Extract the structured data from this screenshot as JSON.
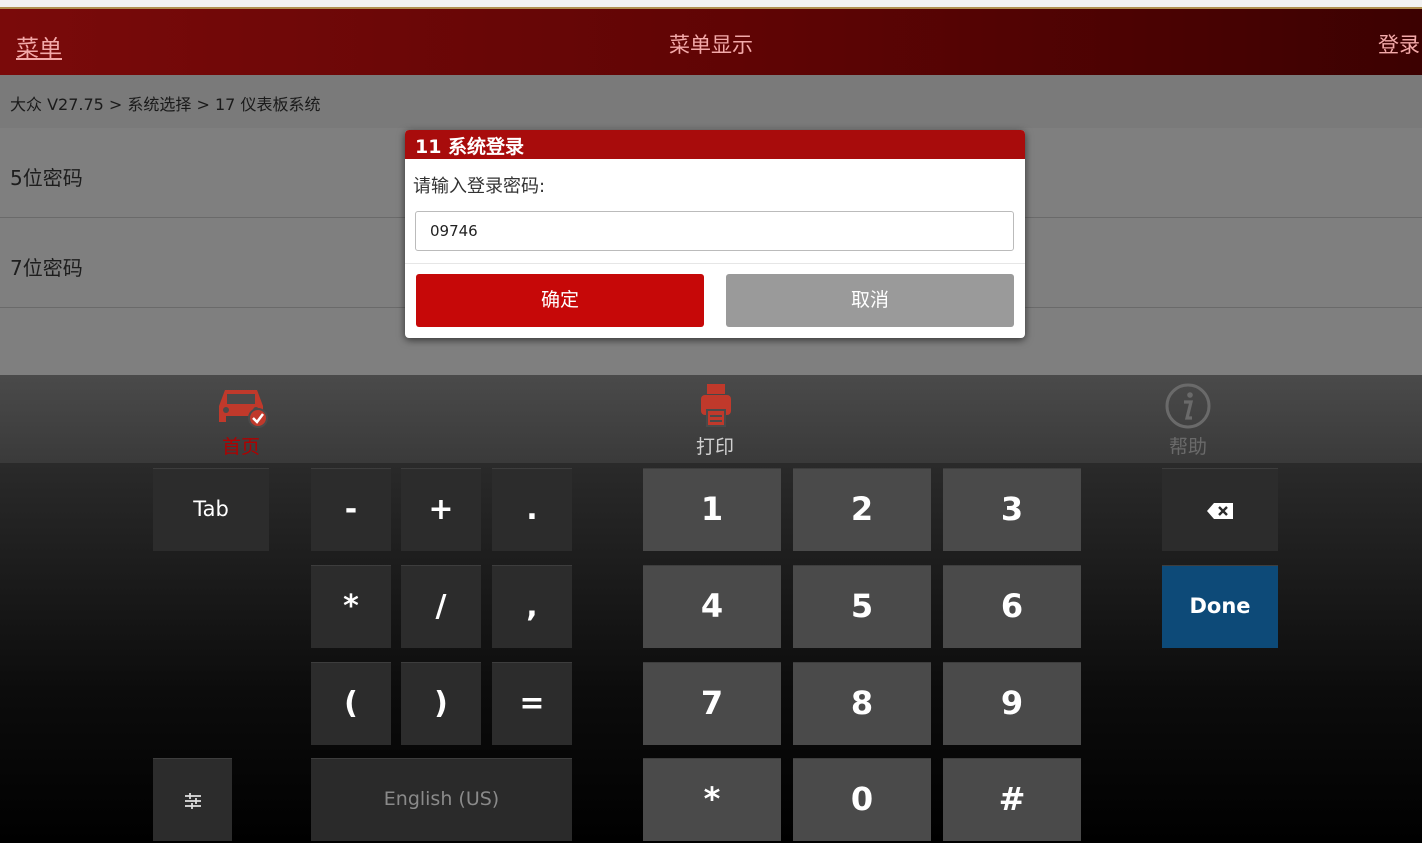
{
  "header": {
    "menu": "菜单",
    "title": "菜单显示",
    "login": "登录"
  },
  "breadcrumb": "大众 V27.75 > 系统选择 > 17 仪表板系统",
  "list": {
    "items": [
      "5位密码",
      "7位密码",
      ""
    ]
  },
  "toolbar": {
    "home": {
      "label": "首页",
      "icon": "car-check-icon"
    },
    "print": {
      "label": "打印",
      "icon": "printer-icon"
    },
    "help": {
      "label": "帮助",
      "icon": "info-icon"
    }
  },
  "dialog": {
    "title": "11 系统登录",
    "prompt": "请输入登录密码:",
    "password": "09746",
    "ok": "确定",
    "cancel": "取消"
  },
  "keyboard": {
    "tab": "Tab",
    "symbols": [
      "-",
      "+",
      ".",
      "*",
      "/",
      ",",
      "(",
      ")",
      "="
    ],
    "digits": [
      "1",
      "2",
      "3",
      "4",
      "5",
      "6",
      "7",
      "8",
      "9",
      "*",
      "0",
      "#"
    ],
    "done": "Done",
    "language": "English (US)",
    "backspace_icon": "backspace-icon",
    "settings_icon": "settings-sliders-icon"
  },
  "colors": {
    "header_red": "#7a0a0a",
    "dialog_red": "#a80c0c",
    "ok_red": "#c60808",
    "done_blue": "#0d4a78"
  }
}
